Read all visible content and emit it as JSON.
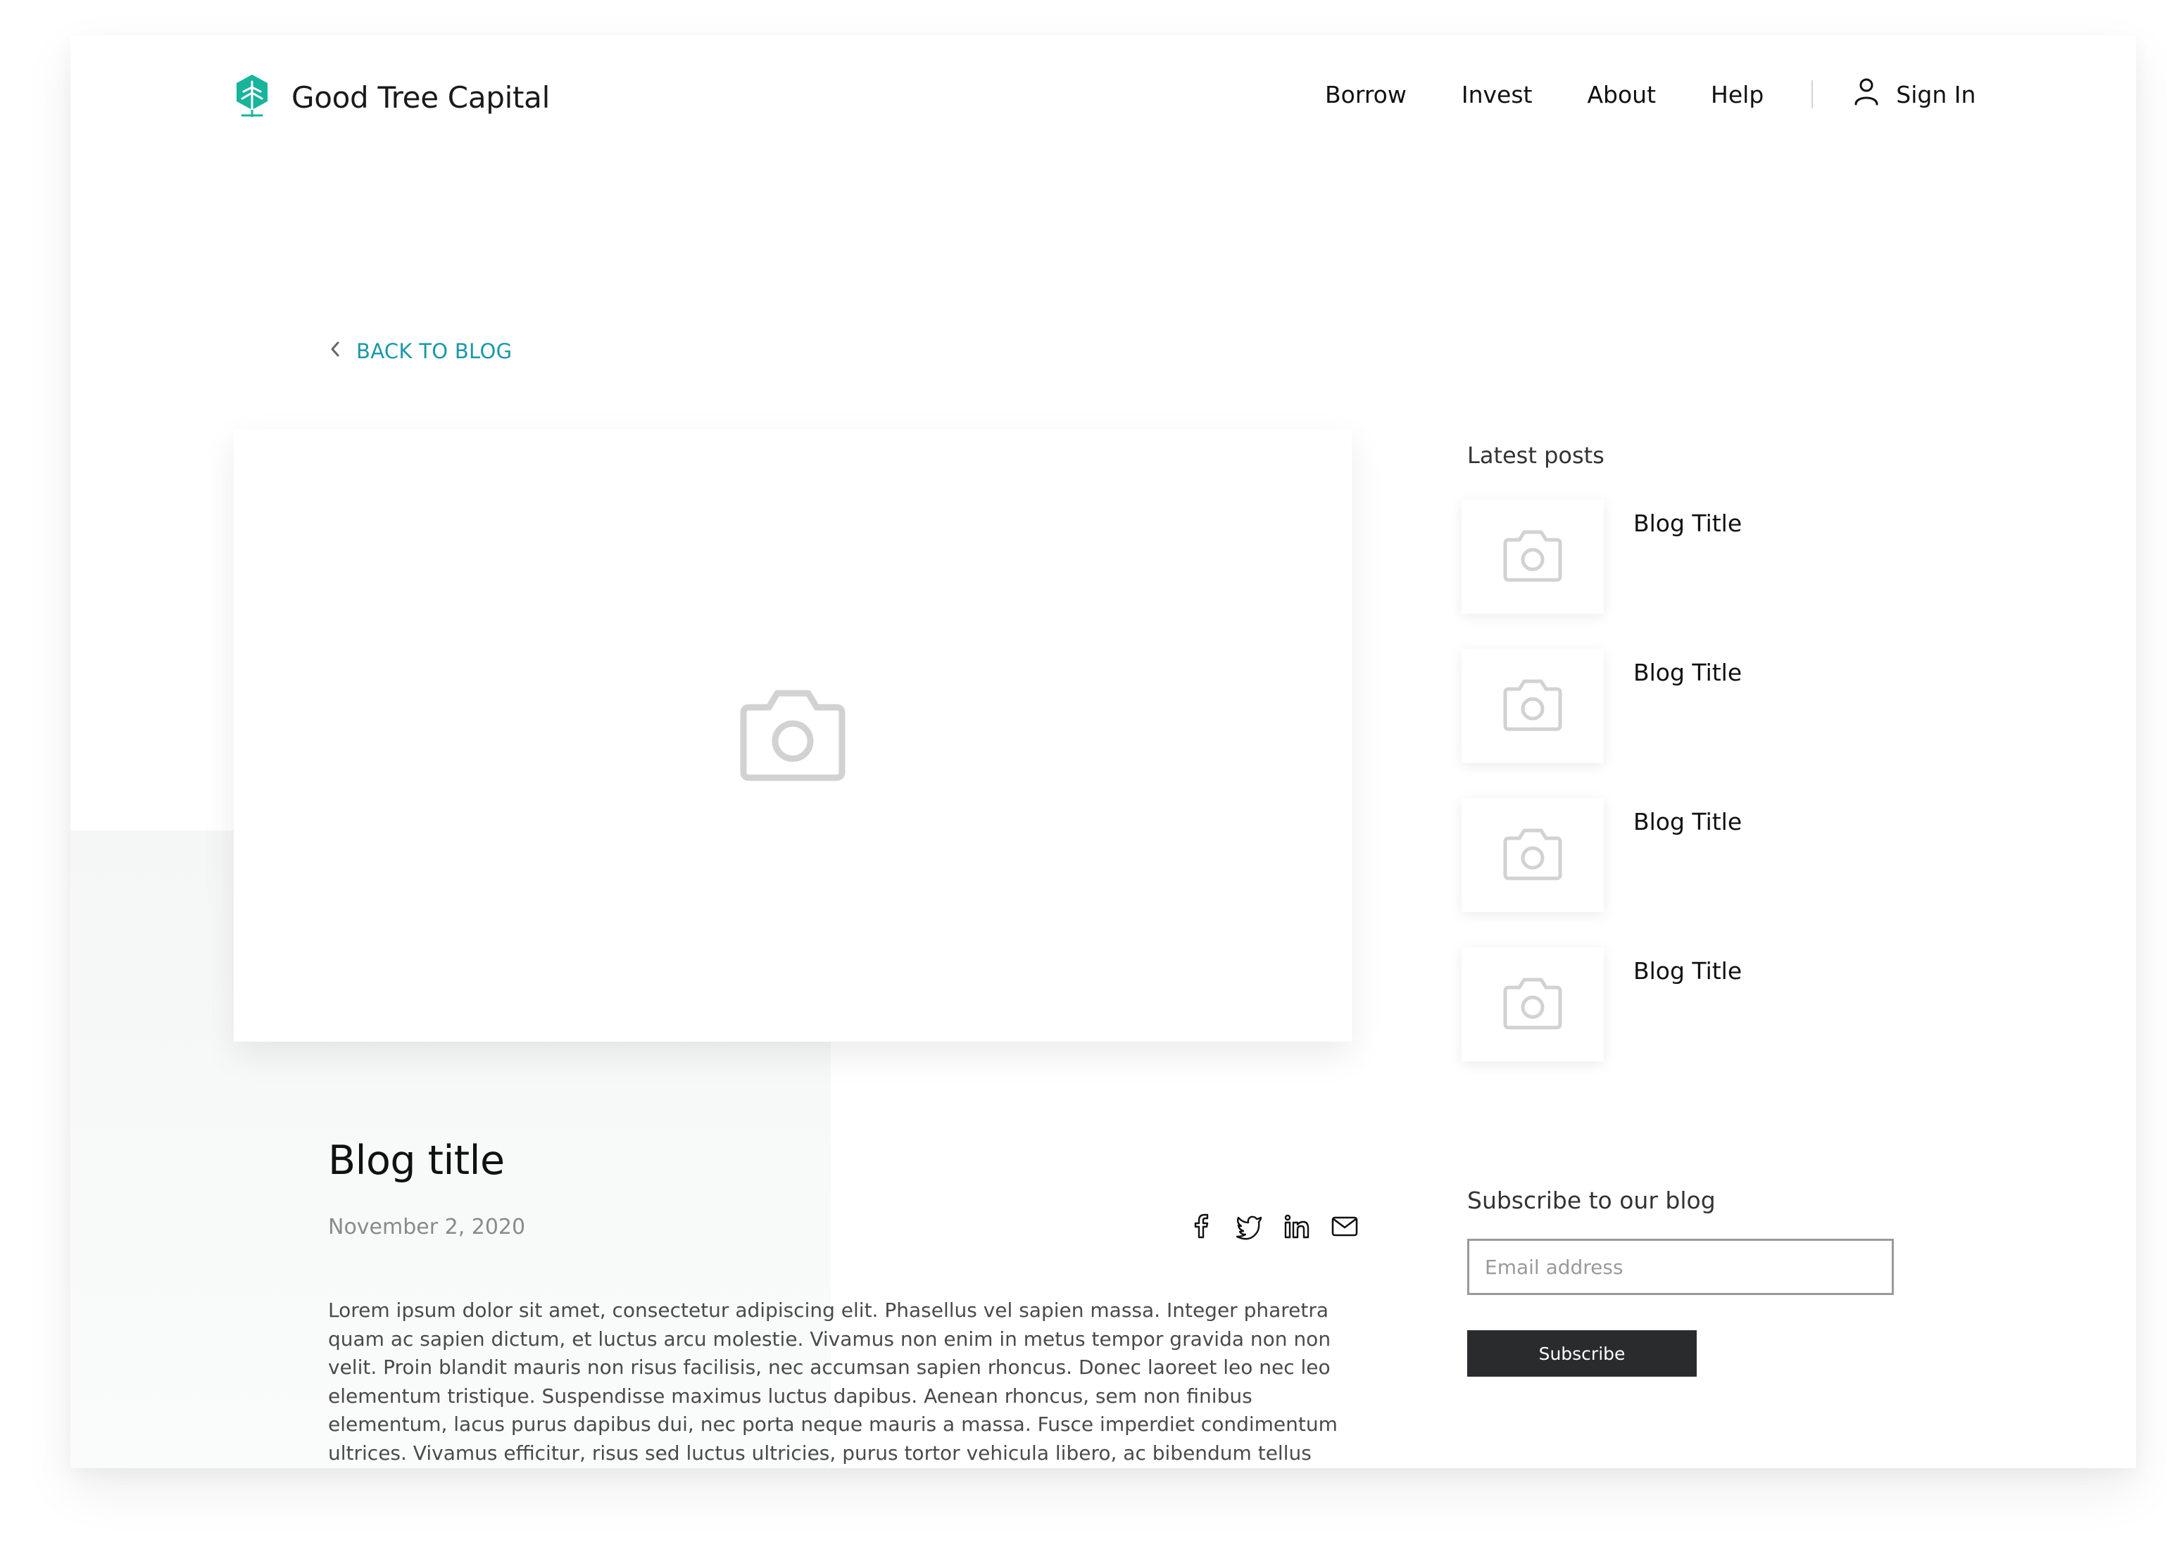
{
  "brand": {
    "name": "Good Tree Capital",
    "accent_color": "#19b49c",
    "link_color": "#1a98a8",
    "logo_icon": "tree-logo-icon"
  },
  "nav": {
    "items": [
      {
        "label": "Borrow"
      },
      {
        "label": "Invest"
      },
      {
        "label": "About"
      },
      {
        "label": "Help"
      }
    ],
    "signin_label": "Sign In",
    "signin_icon": "user-icon"
  },
  "back_link": {
    "label": "BACK TO BLOG",
    "icon": "chevron-left-icon"
  },
  "hero": {
    "icon": "camera-icon"
  },
  "post": {
    "title": "Blog title",
    "date": "November 2, 2020",
    "share_icons": [
      "facebook-icon",
      "twitter-icon",
      "linkedin-icon",
      "email-icon"
    ],
    "body": "Lorem ipsum dolor sit amet, consectetur adipiscing elit. Phasellus vel sapien massa. Integer pharetra quam ac sapien dictum, et luctus arcu molestie. Vivamus non enim in metus tempor gravida non non velit. Proin blandit mauris non risus facilisis, nec accumsan sapien rhoncus. Donec laoreet leo nec leo elementum tristique. Suspendisse maximus luctus dapibus. Aenean rhoncus, sem non finibus elementum, lacus purus dapibus dui, nec porta neque mauris a massa. Fusce imperdiet condimentum ultrices. Vivamus efficitur, risus sed luctus ultricies, purus tortor vehicula libero, ac bibendum tellus magna nec orci. Aliquam pulvinar, urna ac congue"
  },
  "sidebar": {
    "latest_heading": "Latest posts",
    "posts": [
      {
        "title": "Blog Title"
      },
      {
        "title": "Blog Title"
      },
      {
        "title": "Blog Title"
      },
      {
        "title": "Blog Title"
      }
    ],
    "subscribe": {
      "heading": "Subscribe to our blog",
      "placeholder": "Email address",
      "value": "",
      "button_label": "Subscribe"
    }
  }
}
